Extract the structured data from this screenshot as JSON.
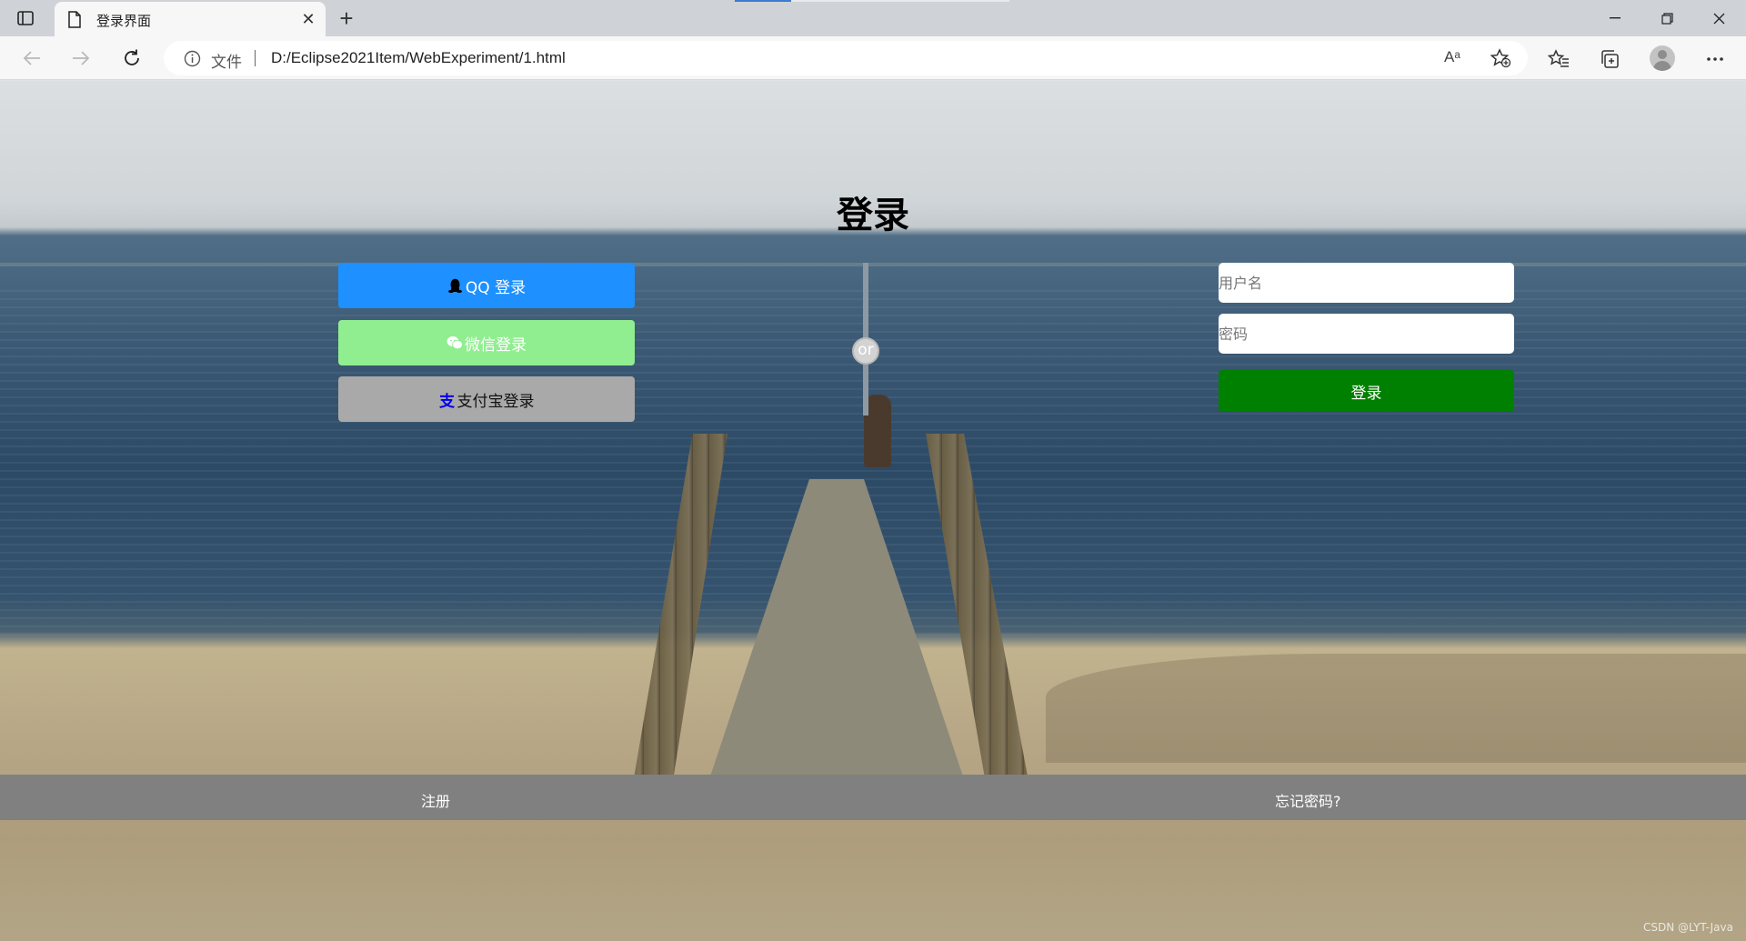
{
  "browser": {
    "tab_title": "登录界面",
    "address_label": "文件",
    "url": "D:/Eclipse2021Item/WebExperiment/1.html",
    "read_aloud": "Aᵃ"
  },
  "page": {
    "title": "登录",
    "social": {
      "qq_label": "QQ 登录",
      "wechat_label": "微信登录",
      "alipay_label": "支付宝登录",
      "alipay_glyph": "支"
    },
    "or_label": "or",
    "form": {
      "username_placeholder": "用户名",
      "password_placeholder": "密码",
      "submit_label": "登录"
    },
    "footer": {
      "register_label": "注册",
      "forgot_label": "忘记密码?"
    },
    "watermark": "CSDN @LYT-Java"
  },
  "colors": {
    "qq": "#1e90ff",
    "wechat": "#90ee90",
    "alipay": "#a9a9a9",
    "submit": "#008000",
    "footer": "#808080"
  }
}
